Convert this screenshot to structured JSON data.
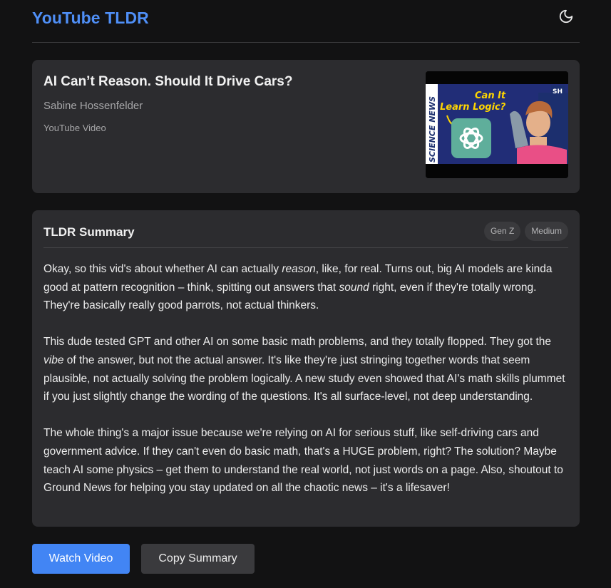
{
  "app": {
    "title": "YouTube TLDR"
  },
  "header": {
    "theme_icon": "moon-icon"
  },
  "video": {
    "title": "AI Can’t Reason. Should It Drive Cars?",
    "channel": "Sabine Hossenfelder",
    "type": "YouTube Video",
    "thumbnail": {
      "side_text": "SCIENCE NEWS",
      "headline_line1": "Can It",
      "headline_line2": "Learn Logic?",
      "badge": "SH",
      "colors": {
        "headline": "#ffd600",
        "background": "#1c2f6e",
        "logo_bg": "#5fae9b",
        "stripe": "#ffffff"
      }
    }
  },
  "summary": {
    "title": "TLDR Summary",
    "tags": [
      "Gen Z",
      "Medium"
    ],
    "p1": {
      "a": "Okay, so this vid's about whether AI can actually ",
      "em1": "reason",
      "b": ", like, for real. Turns out, big AI models are kinda good at pattern recognition – think, spitting out answers that ",
      "em2": "sound",
      "c": " right, even if they're totally wrong. They're basically really good parrots, not actual thinkers."
    },
    "p2": {
      "a": "This dude tested GPT and other AI on some basic math problems, and they totally flopped. They got the ",
      "em1": "vibe",
      "b": " of the answer, but not the actual answer. It's like they're just stringing together words that seem plausible, not actually solving the problem logically. A new study even showed that AI's math skills plummet if you just slightly change the wording of the questions. It's all surface-level, not deep understanding."
    },
    "p3": "The whole thing's a major issue because we're relying on AI for serious stuff, like self-driving cars and government advice. If they can't even do basic math, that's a HUGE problem, right? The solution? Maybe teach AI some physics – get them to understand the real world, not just words on a page. Also, shoutout to Ground News for helping you stay updated on all the chaotic news – it's a lifesaver!"
  },
  "actions": {
    "watch_label": "Watch Video",
    "copy_label": "Copy Summary"
  },
  "colors": {
    "accent": "#4285f4",
    "background": "#121213",
    "card": "#2c2c2f"
  }
}
